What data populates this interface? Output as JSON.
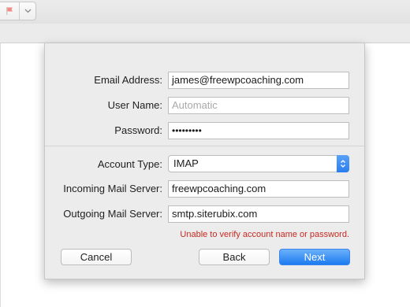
{
  "toolbar": {
    "flag_icon": "flag-icon",
    "chevron_icon": "chevron-down-icon"
  },
  "form": {
    "email": {
      "label": "Email Address:",
      "value": "james@freewpcoaching.com"
    },
    "username": {
      "label": "User Name:",
      "placeholder": "Automatic"
    },
    "password": {
      "label": "Password:",
      "value": "•••••••••"
    },
    "account_type": {
      "label": "Account Type:",
      "value": "IMAP"
    },
    "incoming": {
      "label": "Incoming Mail Server:",
      "value": "freewpcoaching.com"
    },
    "outgoing": {
      "label": "Outgoing Mail Server:",
      "value": "smtp.siterubix.com"
    }
  },
  "error_message": "Unable to verify account name or password.",
  "buttons": {
    "cancel": "Cancel",
    "back": "Back",
    "next": "Next"
  },
  "colors": {
    "accent": "#1c7bf0",
    "error": "#c62a22",
    "flag": "#e8625a"
  }
}
